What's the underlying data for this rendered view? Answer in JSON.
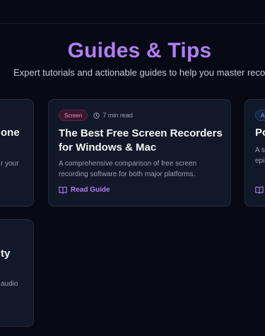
{
  "header": {
    "title": "Guides & Tips",
    "subtitle": "Expert tutorials and actionable guides to help you master recording."
  },
  "cards": [
    {
      "title": "one",
      "description": "r your"
    },
    {
      "tag": "Screen",
      "read_time": "7 min read",
      "title": "The Best Free Screen Recorders for Windows & Mac",
      "description": "A comprehensive comparison of free screen recording software for both major platforms.",
      "cta": "Read Guide"
    },
    {
      "tag": "Au",
      "title": "Po",
      "description_lines": [
        "A s",
        "epis"
      ]
    },
    {
      "title": "ty",
      "description": "audio"
    }
  ],
  "colors": {
    "background": "#070914",
    "card": "#111827",
    "accent": "#b07ef3"
  },
  "icons": {
    "clock": "clock-icon",
    "book": "book-open-icon"
  }
}
